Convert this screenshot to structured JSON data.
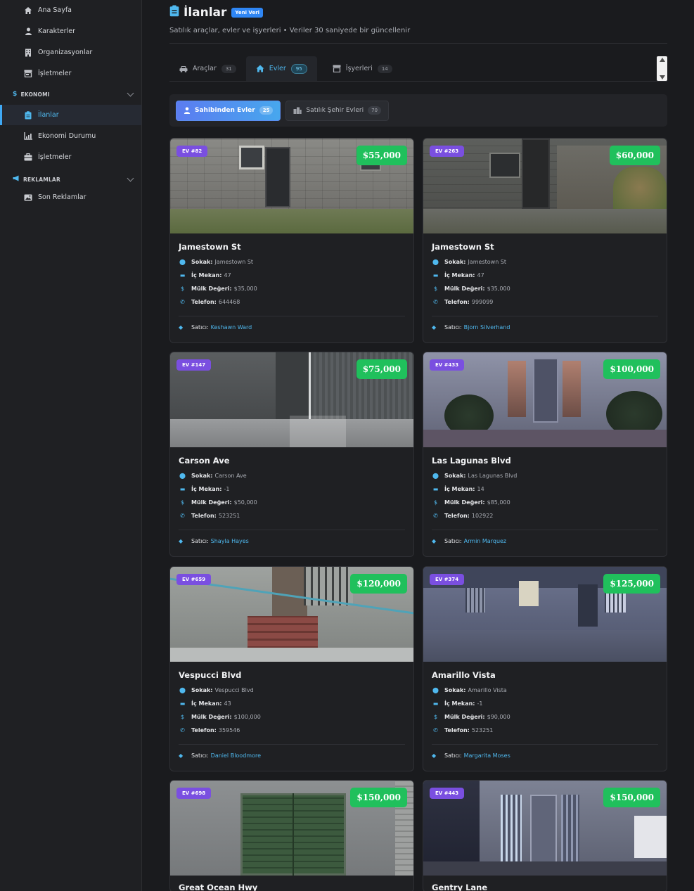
{
  "sidebar": {
    "top_items": [
      {
        "label": "Ana Sayfa",
        "icon": "home-icon"
      },
      {
        "label": "Karakterler",
        "icon": "user-icon"
      },
      {
        "label": "Organizasyonlar",
        "icon": "building-icon"
      },
      {
        "label": "İşletmeler",
        "icon": "store-icon"
      }
    ],
    "sections": [
      {
        "title": "EKONOMI",
        "icon": "dollar-icon",
        "items": [
          {
            "label": "İlanlar",
            "icon": "clipboard-icon",
            "active": true
          },
          {
            "label": "Ekonomi Durumu",
            "icon": "chart-icon"
          },
          {
            "label": "İşletmeler",
            "icon": "briefcase-icon"
          }
        ]
      },
      {
        "title": "REKLAMLAR",
        "icon": "megaphone-icon",
        "items": [
          {
            "label": "Son Reklamlar",
            "icon": "image-icon"
          }
        ]
      }
    ]
  },
  "header": {
    "title": "İlanlar",
    "badge": "Yeni Veri",
    "subtitle": "Satılık araçlar, evler ve işyerleri • Veriler 30 saniyede bir güncellenir"
  },
  "tabs": [
    {
      "label": "Araçlar",
      "count": "31",
      "icon": "car-icon"
    },
    {
      "label": "Evler",
      "count": "95",
      "icon": "house-icon",
      "active": true
    },
    {
      "label": "İşyerleri",
      "count": "14",
      "icon": "store-icon"
    }
  ],
  "filters": [
    {
      "label": "Sahibinden Evler",
      "count": "25",
      "icon": "user-icon",
      "active": true
    },
    {
      "label": "Satılık Şehir Evleri",
      "count": "70",
      "icon": "city-icon"
    }
  ],
  "field_labels": {
    "street": "Sokak:",
    "interior": "İç Mekan:",
    "value": "Mülk Değeri:",
    "phone": "Telefon:",
    "seller": "Satıcı:"
  },
  "cards": [
    {
      "badge": "EV #82",
      "price": "$55,000",
      "title": "Jamestown St",
      "street": "Jamestown St",
      "interior": "47",
      "value": "$35,000",
      "phone": "644468",
      "seller": "Keshawn Ward"
    },
    {
      "badge": "EV #263",
      "price": "$60,000",
      "title": "Jamestown St",
      "street": "Jamestown St",
      "interior": "47",
      "value": "$35,000",
      "phone": "999099",
      "seller": "Bjorn Silverhand"
    },
    {
      "badge": "EV #147",
      "price": "$75,000",
      "title": "Carson Ave",
      "street": "Carson Ave",
      "interior": "-1",
      "value": "$50,000",
      "phone": "523251",
      "seller": "Shayla Hayes"
    },
    {
      "badge": "EV #433",
      "price": "$100,000",
      "title": "Las Lagunas Blvd",
      "street": "Las Lagunas Blvd",
      "interior": "14",
      "value": "$85,000",
      "phone": "102922",
      "seller": "Armin Marquez"
    },
    {
      "badge": "EV #659",
      "price": "$120,000",
      "title": "Vespucci Blvd",
      "street": "Vespucci Blvd",
      "interior": "43",
      "value": "$100,000",
      "phone": "359546",
      "seller": "Daniel Bloodmore"
    },
    {
      "badge": "EV #374",
      "price": "$125,000",
      "title": "Amarillo Vista",
      "street": "Amarillo Vista",
      "interior": "-1",
      "value": "$90,000",
      "phone": "523251",
      "seller": "Margarita Moses"
    },
    {
      "badge": "EV #698",
      "price": "$150,000",
      "title": "Great Ocean Hwy"
    },
    {
      "badge": "EV #443",
      "price": "$150,000",
      "title": "Gentry Lane"
    }
  ]
}
